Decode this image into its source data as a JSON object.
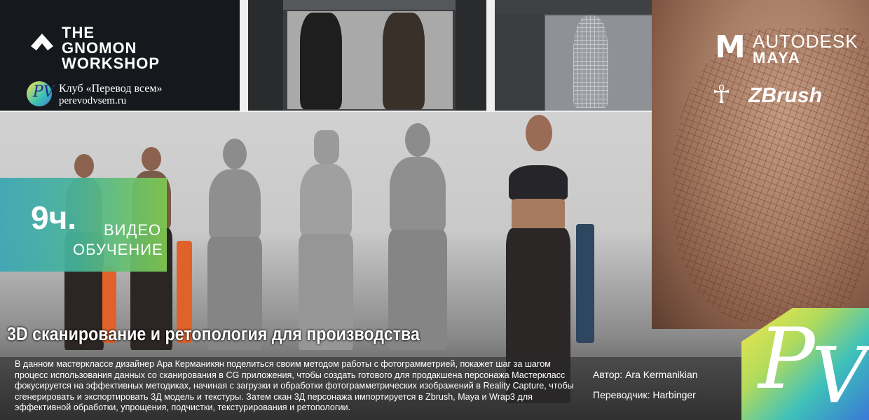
{
  "header": {
    "gnomon_logo_text": "THE GNOMON WORKSHOP",
    "club_name": "Клуб «Перевод всем»",
    "club_site": "perevodvsem.ru",
    "club_badge_text": "PV"
  },
  "brands": {
    "maya_line1": "AUTODESK",
    "maya_line2": "MAYA",
    "zbrush": "ZBrush"
  },
  "duration": {
    "hours": "9ч.",
    "label_line1": "ВИДЕО",
    "label_line2": "ОБУЧЕНИЕ"
  },
  "title": "3D сканирование и ретопология для производства",
  "description": "В данном мастерклассе дизайнер Ара Керманикян поделиться своим методом работы с фотограмметрией, покажет шаг за шагом процесс использования данных со сканирования в CG приложения, чтобы создать готового для продакшена персонажа Мастеркласс фокусируется на эффективных методиках, начиная с загрузки и обработки фотограмметрических изображений в Reality Capture, чтобы сгенерировать и экспортировать 3Д модель и текстуры. Затем скан 3Д персонажа импортируется в Zbrush, Maya и Wrap3 для эффективной обработки, упрощения, подчистки, текстурирования и ретопологии.",
  "credits": {
    "author": "Автор: Ara Kermanikian",
    "translator": "Переводчик: Harbinger"
  },
  "pv_logo": "PV",
  "colors": {
    "accent_teal": "#3aa6b3",
    "accent_green": "#7fc94f",
    "accent_yellow": "#f4e84b",
    "accent_blue": "#3979d6"
  }
}
